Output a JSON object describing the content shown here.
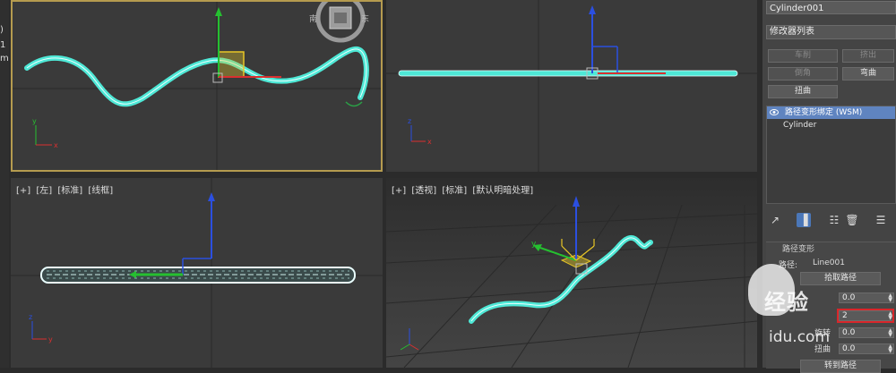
{
  "left_strip": {
    "glyphs": [
      ")",
      "1",
      "m"
    ]
  },
  "viewports": {
    "top": {
      "nav_cube_labels": [
        "南",
        "东"
      ]
    },
    "front": {},
    "left": {
      "labels": [
        "[+]",
        "[左]",
        "[标准]",
        "[线框]"
      ]
    },
    "perspective": {
      "labels": [
        "[+]",
        "[透视]",
        "[标准]",
        "[默认明暗处理]"
      ]
    }
  },
  "panel": {
    "object_name": "Cylinder001",
    "modifier_list": "修改器列表",
    "buttons": [
      {
        "label": "车削",
        "enabled": false
      },
      {
        "label": "挤出",
        "enabled": false
      },
      {
        "label": "倒角",
        "enabled": false
      },
      {
        "label": "弯曲",
        "enabled": true
      },
      {
        "label": "扭曲",
        "enabled": true
      }
    ],
    "stack": [
      {
        "label": "路径变形绑定 (WSM)",
        "selected": true
      },
      {
        "label": "Cylinder",
        "selected": false
      }
    ],
    "toolbar_icons": [
      "pin-icon",
      "show-end-result-icon",
      "make-unique-icon",
      "remove-modifier-icon",
      "configure-icon"
    ],
    "rollout": {
      "title": "路径变形",
      "path_label": "路径:",
      "path_value": "Line001",
      "pick_path_button": "拾取路径",
      "percent_value": "0.0",
      "stretch_value": "2",
      "rotation_label": "旋转",
      "rotation_value": "0.0",
      "twist_label": "扭曲",
      "twist_value": "0.0",
      "move_to_path_button": "转到路径"
    }
  },
  "watermark": {
    "text1": "经验",
    "text2": "idu.com"
  },
  "colors": {
    "spline": "#4ee8d6",
    "selection_border": "#b59b4f",
    "stack_selected": "#5f84c0",
    "highlight_box": "#d9262a"
  }
}
